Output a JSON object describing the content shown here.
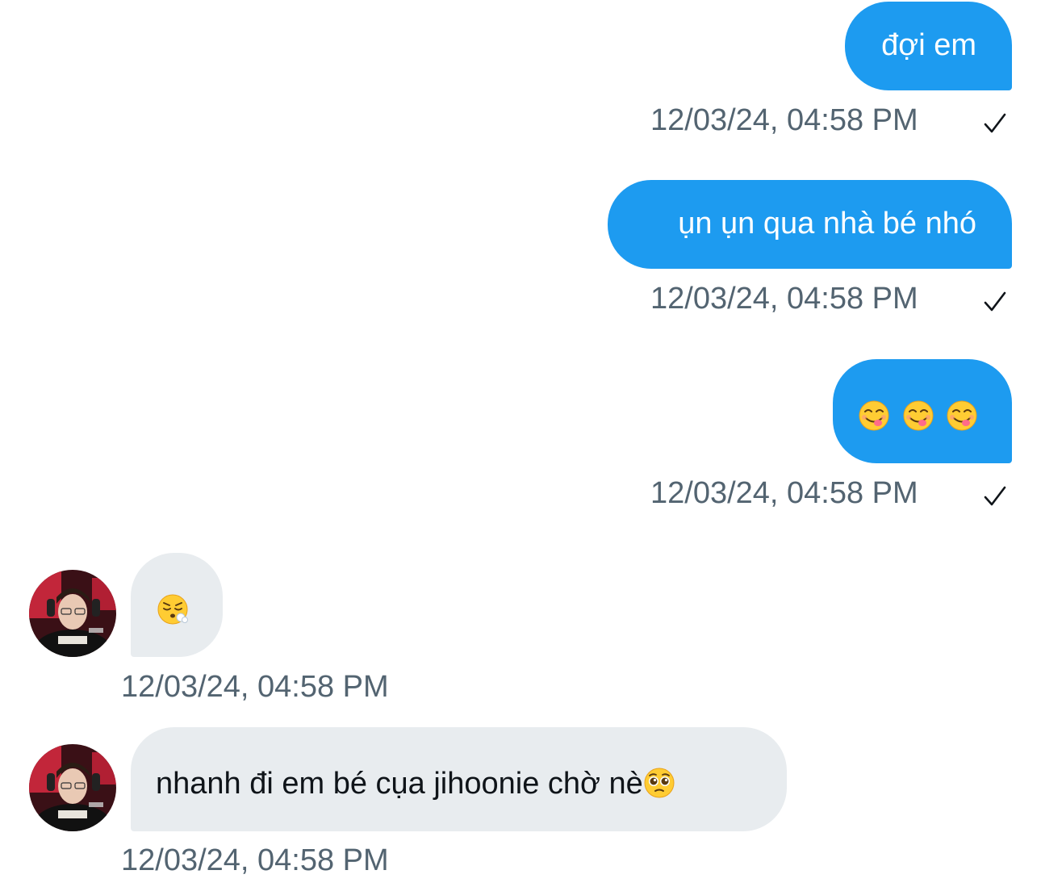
{
  "colors": {
    "outgoing_bubble": "#1d9bf0",
    "incoming_bubble": "#e8ecef",
    "timestamp": "#536471"
  },
  "messages": [
    {
      "direction": "outgoing",
      "text": "đợi em",
      "timestamp": "12/03/24, 04:58 PM",
      "status_icon": "checkmark-icon"
    },
    {
      "direction": "outgoing",
      "text": "ụn ụn qua nhà bé nhó",
      "timestamp": "12/03/24, 04:58 PM",
      "status_icon": "checkmark-icon"
    },
    {
      "direction": "outgoing",
      "emojis": [
        "face-savoring-food-emoji",
        "face-savoring-food-emoji",
        "face-savoring-food-emoji"
      ],
      "timestamp": "12/03/24, 04:58 PM",
      "status_icon": "checkmark-icon"
    },
    {
      "direction": "incoming",
      "avatar": "avatar",
      "emojis": [
        "face-exhaling-emoji"
      ],
      "timestamp": "12/03/24, 04:58 PM"
    },
    {
      "direction": "incoming",
      "avatar": "avatar",
      "text": "nhanh đi em bé cụa jihoonie chờ nè",
      "trailing_emoji": "pleading-face-emoji",
      "timestamp": "12/03/24, 04:58 PM"
    }
  ]
}
